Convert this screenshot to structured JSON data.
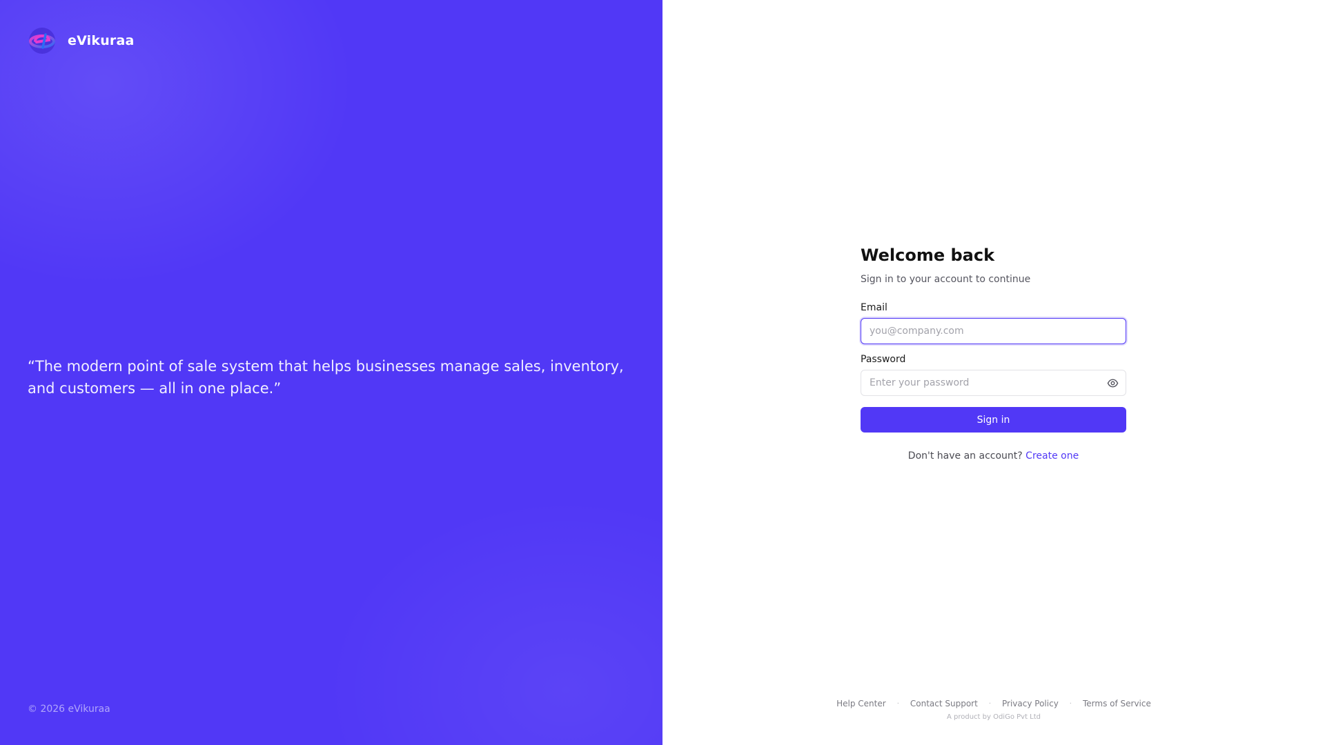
{
  "brand": {
    "name": "eVikuraa",
    "colors": {
      "accent": "#5138f6",
      "logo_pink": "#e53bd0",
      "logo_blue": "#2b6cf6"
    }
  },
  "hero": {
    "quote": "“The modern point of sale system that helps businesses manage sales, inventory, and customers — all in one place.”",
    "copyright": "© 2026 eVikuraa"
  },
  "form": {
    "title": "Welcome back",
    "subtitle": "Sign in to your account to continue",
    "email": {
      "label": "Email",
      "placeholder": "you@company.com",
      "value": ""
    },
    "password": {
      "label": "Password",
      "placeholder": "Enter your password",
      "value": "",
      "toggle_icon": "eye-icon"
    },
    "submit_label": "Sign in",
    "signup_prompt": "Don't have an account?",
    "signup_link": "Create one"
  },
  "footer": {
    "links": [
      "Help Center",
      "Contact Support",
      "Privacy Policy",
      "Terms of Service"
    ],
    "separator": "·",
    "product_line": "A product by OdiGo Pvt Ltd"
  }
}
